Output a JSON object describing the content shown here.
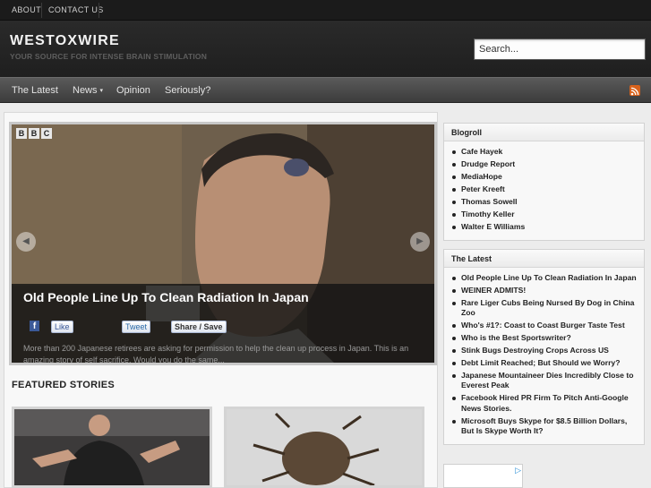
{
  "topbar": {
    "links": [
      "ABOUT",
      "CONTACT US"
    ]
  },
  "header": {
    "title": "WESTOXWIRE",
    "tagline": "YOUR SOURCE FOR INTENSE BRAIN STIMULATION",
    "search_placeholder": "Search..."
  },
  "nav": {
    "items": [
      "The Latest",
      "News",
      "Opinion",
      "Seriously?"
    ],
    "news_caret": "▾"
  },
  "slider": {
    "logo": [
      "B",
      "B",
      "C"
    ],
    "title": "Old People Line Up To Clean Radiation In Japan",
    "like_label": "Like",
    "tweet_label": "Tweet",
    "share_label": "Share / Save",
    "description": "More than 200 Japanese retirees are asking for permission to help the clean up process in Japan. This is an amazing story of self sacrifice. Would you do the same..."
  },
  "featured": {
    "heading": "FEATURED STORIES"
  },
  "sidebar": {
    "blogroll_title": "Blogroll",
    "blogroll": [
      "Cafe Hayek",
      "Drudge Report",
      "MediaHope",
      "Peter Kreeft",
      "Thomas Sowell",
      "Timothy Keller",
      "Walter E Williams"
    ],
    "latest_title": "The Latest",
    "latest": [
      "Old People Line Up To Clean Radiation In Japan",
      "WEINER ADMITS!",
      "Rare Liger Cubs Being Nursed By Dog in China Zoo",
      "Who's #1?: Coast to Coast Burger Taste Test",
      "Who is the Best Sportswriter?",
      "Stink Bugs Destroying Crops Across US",
      "Debt Limit Reached; But Should we Worry?",
      "Japanese Mountaineer Dies Incredibly Close to Everest Peak",
      "Facebook Hired PR Firm To Pitch Anti-Google News Stories.",
      "Microsoft Buys Skype for $8.5 Billion Dollars, But Is Skype Worth It?"
    ]
  },
  "colors": {
    "accent_rss": "#d9621b",
    "facebook": "#3b5998",
    "adchoices": "#2a8fd6"
  },
  "icons": {
    "rss": "rss-icon",
    "facebook": "facebook-icon",
    "arrow_left": "arrow-left-icon",
    "arrow_right": "arrow-right-icon",
    "adchoices": "adchoices-icon"
  }
}
